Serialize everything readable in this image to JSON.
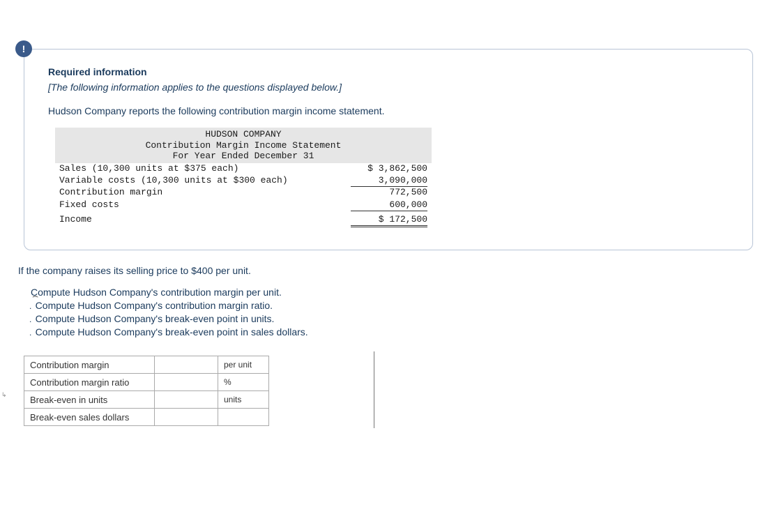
{
  "icon_label": "!",
  "card": {
    "required_title": "Required information",
    "subnote": "[The following information applies to the questions displayed below.]",
    "lead": "Hudson Company reports the following contribution margin income statement."
  },
  "statement": {
    "header1": "HUDSON COMPANY",
    "header2": "Contribution Margin Income Statement",
    "header3": "For Year Ended December 31",
    "rows": {
      "sales_label": "Sales (10,300 units at $375 each)",
      "sales_amount": "$ 3,862,500",
      "varcost_label": "Variable costs (10,300 units at $300 each)",
      "varcost_amount": "3,090,000",
      "cm_label": "Contribution margin",
      "cm_amount": "772,500",
      "fixed_label": "Fixed costs",
      "fixed_amount": "600,000",
      "income_label": "Income",
      "income_amount": "$ 172,500"
    }
  },
  "question": {
    "lead": "If the company raises its selling price to $400 per unit.",
    "items": [
      "Compute Hudson Company's contribution margin per unit.",
      "Compute Hudson Company's contribution margin ratio.",
      "Compute Hudson Company's break-even point in units.",
      "Compute Hudson Company's break-even point in sales dollars."
    ]
  },
  "answers": {
    "rows": [
      {
        "prefix": ".",
        "label": "Contribution margin",
        "unit": "per unit"
      },
      {
        "prefix": ".",
        "label": "Contribution margin ratio",
        "unit": "%"
      },
      {
        "prefix": ".",
        "label": "Break-even in units",
        "unit": "units"
      },
      {
        "prefix": "",
        "label": "Break-even sales dollars",
        "unit": ""
      }
    ]
  }
}
